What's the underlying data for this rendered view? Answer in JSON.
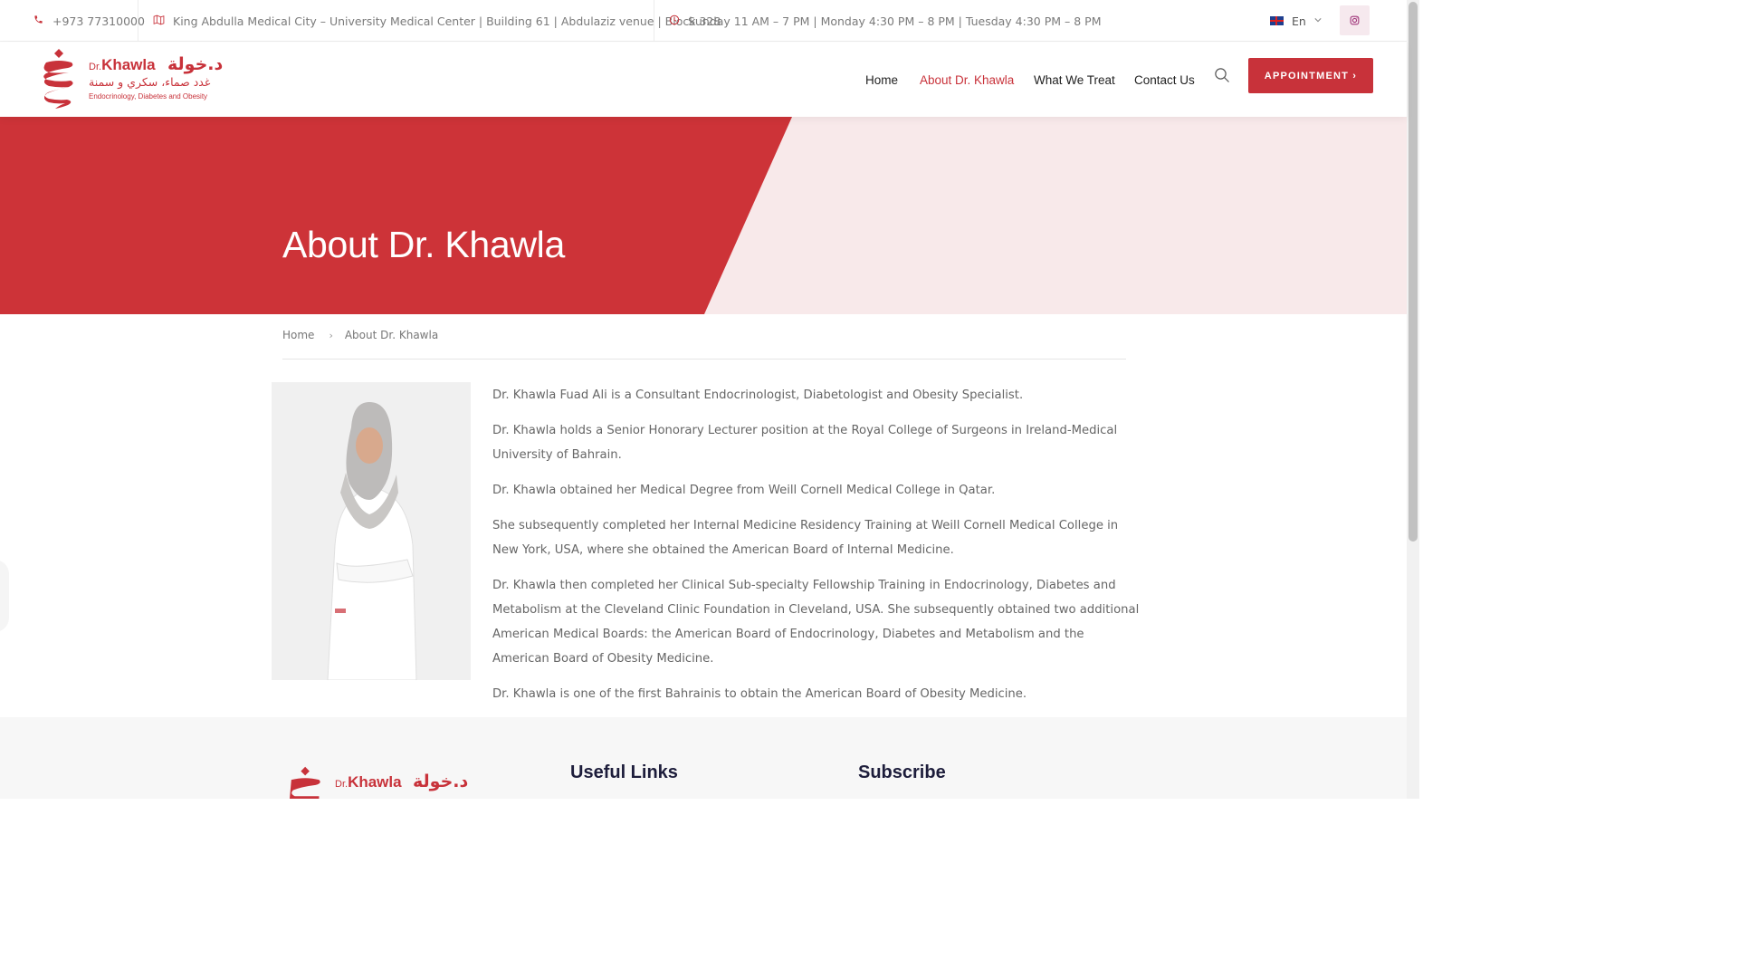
{
  "topbar": {
    "phone": "+973 77310000",
    "address": "King Abdulla Medical City – University Medical Center | Building 61 | Abdulaziz venue | Block 328",
    "hours": "Sunday 11 AM – 7 PM | Monday 4:30 PM – 8 PM | Tuesday 4:30 PM – 8 PM",
    "language": "En",
    "icons": {
      "phone": "phone-icon",
      "address": "map-icon",
      "hours": "clock-icon",
      "social": "instagram-icon"
    }
  },
  "brand": {
    "name_prefix": "Dr.",
    "name": "Khawla",
    "name_ar": "د.خولة",
    "tagline_ar": "غدد صماء، سكري و سمنة",
    "tagline_en": "Endocrinology, Diabetes and Obesity",
    "color": "#c8323a"
  },
  "nav": {
    "items": [
      {
        "label": "Home",
        "active": false
      },
      {
        "label": "About Dr. Khawla",
        "active": true
      },
      {
        "label": "What We Treat",
        "active": false
      },
      {
        "label": "Contact Us",
        "active": false
      }
    ],
    "appointment_label": "APPOINTMENT ›"
  },
  "hero": {
    "title": "About Dr. Khawla"
  },
  "breadcrumb": {
    "home": "Home",
    "separator": "›",
    "current": "About Dr. Khawla"
  },
  "about": {
    "paragraphs": [
      "Dr. Khawla Fuad Ali is a Consultant Endocrinologist, Diabetologist and Obesity Specialist.",
      "Dr. Khawla holds a Senior Honorary Lecturer position at the Royal College of Surgeons in Ireland-Medical University of Bahrain.",
      "Dr. Khawla obtained her Medical Degree from Weill Cornell Medical College in Qatar.",
      "She subsequently completed her Internal Medicine Residency Training at Weill Cornell Medical College in New York, USA, where she obtained the American Board of Internal Medicine.",
      "Dr. Khawla then completed her Clinical Sub-specialty Fellowship Training in Endocrinology, Diabetes and Metabolism at the Cleveland Clinic Foundation in Cleveland, USA. She subsequently obtained two additional American Medical Boards: the American Board of Endocrinology, Diabetes and Metabolism and the American Board of Obesity Medicine.",
      "Dr. Khawla is one of the first Bahrainis to obtain the American Board of Obesity Medicine."
    ]
  },
  "footer": {
    "useful_links_title": "Useful Links",
    "subscribe_title": "Subscribe"
  }
}
